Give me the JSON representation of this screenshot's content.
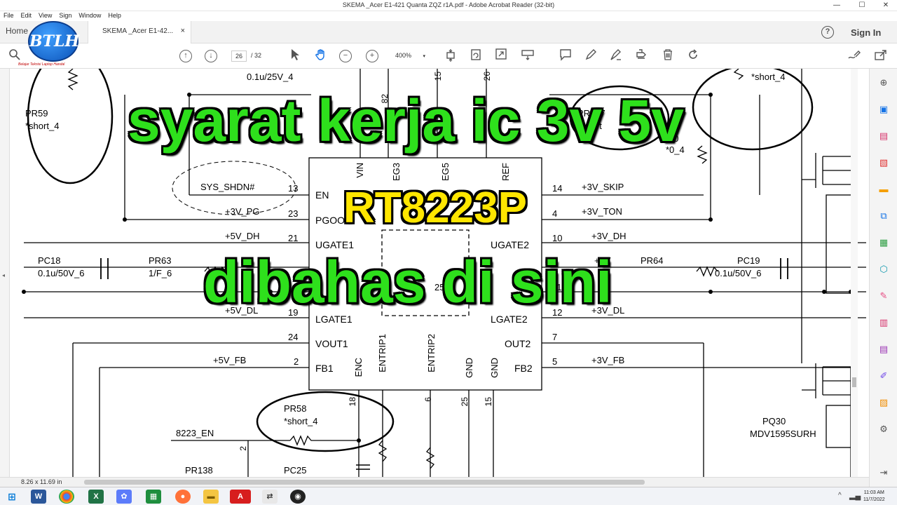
{
  "window": {
    "title": "SKEMA _Acer E1-421 Quanta ZQZ r1A.pdf - Adobe Acrobat Reader (32-bit)",
    "minimize": "—",
    "maximize": "☐",
    "close": "✕"
  },
  "menu": [
    "File",
    "Edit",
    "View",
    "Sign",
    "Window",
    "Help"
  ],
  "tabs": {
    "home": "Home",
    "doc": "SKEMA _Acer E1-42...",
    "close": "×",
    "help": "?",
    "signin": "Sign In"
  },
  "toolbar": {
    "page_current": "26",
    "page_total": "/ 32",
    "zoom": "400%"
  },
  "logo": {
    "text": "BTLH",
    "sub": "Belajar Teknisi Laptop Handal"
  },
  "overlay": {
    "line1": "syarat kerja ic 3v 5v",
    "line2": "RT8223P",
    "line3": "dibahas di sini"
  },
  "schematic": {
    "ic_pins_left": [
      {
        "num": "13",
        "name": "EN",
        "net": "SYS_SHDN#"
      },
      {
        "num": "23",
        "name": "PGOOD",
        "net": "+3V_PG"
      },
      {
        "num": "21",
        "name": "UGATE1",
        "net": "+5V_DH"
      },
      {
        "num": "19",
        "name": "LGATE1",
        "net": "+5V_DL"
      },
      {
        "num": "24",
        "name": "VOUT1",
        "net": ""
      },
      {
        "num": "2",
        "name": "FB1",
        "net": "+5V_FB"
      }
    ],
    "ic_pins_right": [
      {
        "num": "14",
        "name": "",
        "net": "+3V_SKIP"
      },
      {
        "num": "4",
        "name": "",
        "net": "+3V_TON"
      },
      {
        "num": "10",
        "name": "UGATE2",
        "net": "+3V_DH"
      },
      {
        "num": "12",
        "name": "LGATE2",
        "net": "+3V_DL"
      },
      {
        "num": "7",
        "name": "OUT2",
        "net": ""
      },
      {
        "num": "5",
        "name": "FB2",
        "net": "+3V_FB"
      }
    ],
    "ic_pins_top": [
      "VIN",
      "EG3",
      "EG5",
      "REF"
    ],
    "ic_pins_bottom": [
      "ENC",
      "ENTRIP1",
      "ENTRIP2",
      "GND",
      "GND"
    ],
    "labels": {
      "pr59": "PR59",
      "pr59_val": "*short_4",
      "cap_top": "0.1u/25V_4",
      "pr147": "PR147",
      "pr147_val": "short",
      "r50": "50",
      "r50_val": "*0_4",
      "short_top": "*short_4",
      "pc18": "PC18",
      "pc18_val": "0.1u/50V_6",
      "pr63": "PR63",
      "pr63_val": "1/F_6",
      "pr64": "PR64",
      "pc19": "PC19",
      "pc19_val": "0.1u/50V_6",
      "pr58": "PR58",
      "pr58_val": "*short_4",
      "en_8223": "8223_EN",
      "pr138": "PR138",
      "pc25": "PC25",
      "pq30": "PQ30",
      "pq30_val": "MDV1595SURH",
      "n82": "82",
      "n15": "15",
      "n26": "26",
      "n18": "18",
      "n6": "6",
      "n25": "25",
      "n15b": "15",
      "n2": "2",
      "n25b": "25",
      "n11": "11",
      "n9": "9",
      "n3v": "+3V"
    }
  },
  "statusbar": {
    "size": "8.26 x 11.69 in"
  },
  "taskbar": {
    "time": "11:03 AM",
    "date": "11/7/2022"
  }
}
